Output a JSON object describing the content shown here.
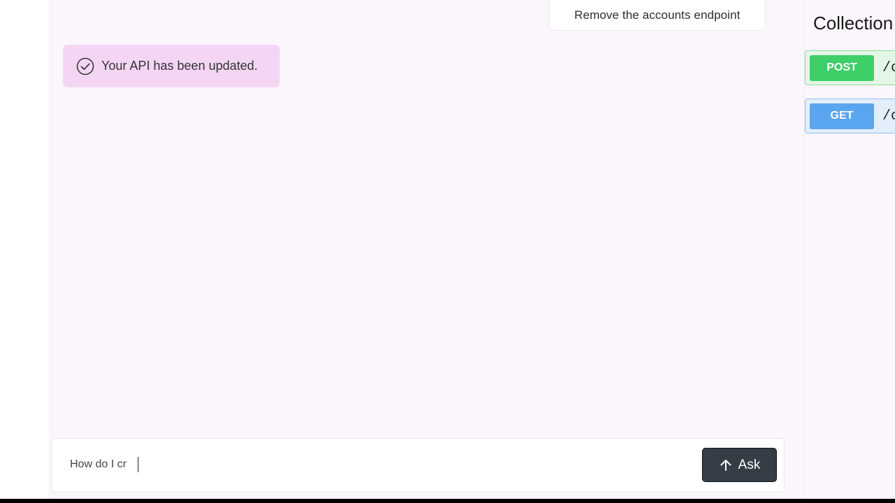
{
  "chat": {
    "user_message": "Remove the accounts endpoint",
    "status_message": "Your API has been updated."
  },
  "composer": {
    "input_value": "How do I cr",
    "ask_label": "Ask"
  },
  "collections": {
    "title": "Collection",
    "endpoints": [
      {
        "method": "POST",
        "path": "/c",
        "color": "#3fcf68"
      },
      {
        "method": "GET",
        "path": "/c",
        "color": "#5aa5ef"
      }
    ]
  },
  "colors": {
    "status_background": "#f4d6f4",
    "ask_button": "#353d47",
    "panel_background": "#faf6fb"
  },
  "icons": {
    "status": "check-circle-icon",
    "ask": "arrow-up-icon"
  }
}
